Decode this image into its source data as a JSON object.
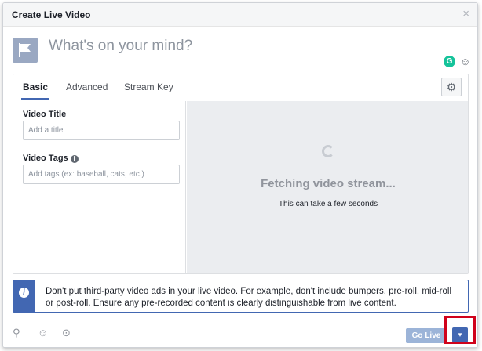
{
  "dialog": {
    "title": "Create Live Video",
    "close_glyph": "×"
  },
  "composer": {
    "placeholder": "What's on your mind?",
    "grammarly_glyph": "G",
    "emoji_glyph": "☺"
  },
  "tabs": {
    "items": [
      {
        "label": "Basic",
        "active": true
      },
      {
        "label": "Advanced",
        "active": false
      },
      {
        "label": "Stream Key",
        "active": false
      }
    ],
    "settings_glyph": "⚙"
  },
  "form": {
    "title_label": "Video Title",
    "title_placeholder": "Add a title",
    "tags_label": "Video Tags",
    "tags_info_glyph": "i",
    "tags_placeholder": "Add tags (ex: baseball, cats, etc.)"
  },
  "preview": {
    "status": "Fetching video stream...",
    "substatus": "This can take a few seconds"
  },
  "notice": {
    "icon_glyph": "i",
    "text": "Don't put third-party video ads in your live video. For example, don't include bumpers, pre-roll, mid-roll or post-roll. Ensure any pre-recorded content is clearly distinguishable from live content."
  },
  "footer": {
    "tag_people_glyph": "⚲",
    "feeling_glyph": "☺",
    "location_glyph": "⊙",
    "go_live_label": "Go Live",
    "dropdown_glyph": "▾"
  },
  "colors": {
    "accent": "#4267b2",
    "go_live_disabled": "#9cb4d8",
    "highlight": "#d0021b"
  }
}
